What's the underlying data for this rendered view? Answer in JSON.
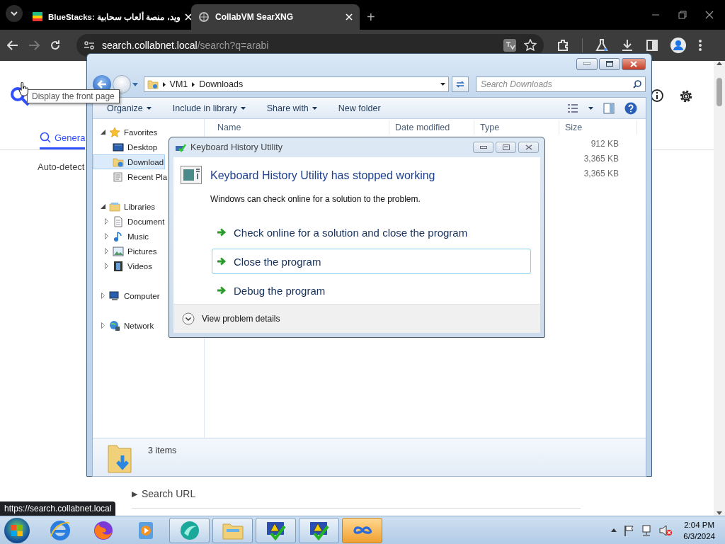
{
  "browser": {
    "tabs": [
      {
        "title": "BlueStacks: ويد، منصة ألعاب سحابية",
        "selected": false,
        "kind": "bluestacks"
      },
      {
        "title": "CollabVM SearXNG",
        "selected": true,
        "kind": "searxng"
      }
    ],
    "new_tab": "+",
    "url": {
      "host": "search.collabnet.local",
      "path": "/search?q=arabi"
    },
    "page": {
      "tabs": [
        {
          "label": "Genera",
          "selected": true
        }
      ],
      "language": "Auto-detect",
      "search_url": "Search URL",
      "search_url_marker": "▶"
    },
    "tooltip": "Display the front page",
    "status_url": "https://search.collabnet.local"
  },
  "explorer": {
    "breadcrumb": [
      "VM1",
      "Downloads"
    ],
    "search_placeholder": "Search Downloads",
    "commands": [
      {
        "label": "Organize",
        "menu": true
      },
      {
        "label": "Include in library",
        "menu": true
      },
      {
        "label": "Share with",
        "menu": true
      },
      {
        "label": "New folder",
        "menu": false
      }
    ],
    "nav": [
      {
        "label": "Favorites",
        "kind": "favorites",
        "expanded": true,
        "children": [
          {
            "label": "Desktop",
            "kind": "desktop",
            "selected": false
          },
          {
            "label": "Download",
            "kind": "downloads",
            "selected": true
          },
          {
            "label": "Recent Pla",
            "kind": "recent",
            "selected": false
          }
        ]
      },
      {
        "label": "Libraries",
        "kind": "libraries",
        "expanded": true,
        "children": [
          {
            "label": "Document",
            "kind": "documents",
            "selected": false,
            "expanded": false
          },
          {
            "label": "Music",
            "kind": "music",
            "selected": false,
            "expanded": false
          },
          {
            "label": "Pictures",
            "kind": "pictures",
            "selected": false,
            "expanded": false
          },
          {
            "label": "Videos",
            "kind": "videos",
            "selected": false,
            "expanded": false
          }
        ]
      },
      {
        "label": "Computer",
        "kind": "computer",
        "expanded": false
      },
      {
        "label": "Network",
        "kind": "network",
        "expanded": false
      }
    ],
    "columns": [
      "Name",
      "Date modified",
      "Type",
      "Size"
    ],
    "rows": [
      {
        "size": "912 KB"
      },
      {
        "size": "3,365 KB"
      },
      {
        "size": "3,365 KB"
      }
    ],
    "status": "3 items"
  },
  "dialog": {
    "title": "Keyboard History Utility",
    "heading": "Keyboard History Utility has stopped working",
    "message": "Windows can check online for a solution to the problem.",
    "options": [
      {
        "label": "Check online for a solution and close the program",
        "selected": false
      },
      {
        "label": "Close the program",
        "selected": true
      },
      {
        "label": "Debug the program",
        "selected": false
      }
    ],
    "details": "View problem details"
  },
  "taskbar": {
    "items": [
      {
        "kind": "ie",
        "running": false,
        "highlighted": false
      },
      {
        "kind": "firefox",
        "running": false,
        "highlighted": false
      },
      {
        "kind": "media",
        "running": false,
        "highlighted": false
      },
      {
        "kind": "globe",
        "running": true,
        "highlighted": false
      },
      {
        "kind": "explorer",
        "running": true,
        "highlighted": false
      },
      {
        "kind": "warning",
        "running": true,
        "highlighted": false
      },
      {
        "kind": "warning",
        "running": true,
        "highlighted": false
      },
      {
        "kind": "infinity",
        "running": true,
        "highlighted": true
      }
    ],
    "clock": {
      "time": "2:04 PM",
      "date": "6/3/2024"
    }
  }
}
